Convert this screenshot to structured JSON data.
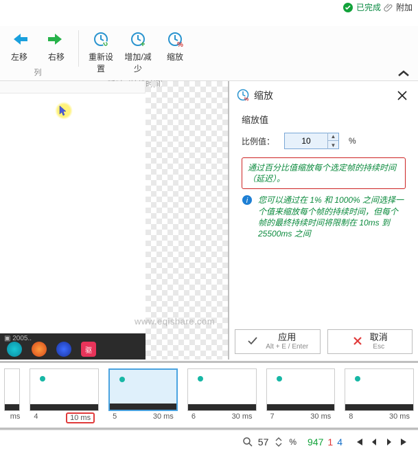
{
  "top": {
    "done": "已完成",
    "attach": "附加"
  },
  "ribbon": {
    "groups": {
      "move": {
        "left": "左移",
        "right": "右移",
        "caption": "列"
      },
      "delay": {
        "reset": "重新设置",
        "inc_dec": "增加/减少",
        "scale": "缩放",
        "caption": "延时（持续时间）"
      }
    }
  },
  "panel": {
    "title": "缩放",
    "section": "缩放值",
    "ratio_label": "比例值：",
    "ratio_value": "10",
    "ratio_unit": "%",
    "tip": "通过百分比值缩放每个选定帧的持续时间（延迟）。",
    "info": "您可以通过在 1% 和 1000% 之间选择一个值来缩放每个帧的持续时间，但每个帧的最终持续时间将限制在 10ms 到 25500ms 之间",
    "apply": "应用",
    "apply_hint": "Alt + E / Enter",
    "cancel": "取消",
    "cancel_hint": "Esc"
  },
  "watermark": "www.eqishare.com",
  "frames": [
    {
      "idx": "",
      "ms": "ms"
    },
    {
      "idx": "4",
      "ms": "10 ms"
    },
    {
      "idx": "5",
      "ms": "30 ms",
      "selected": true
    },
    {
      "idx": "6",
      "ms": "30 ms"
    },
    {
      "idx": "7",
      "ms": "30 ms"
    },
    {
      "idx": "8",
      "ms": "30 ms"
    }
  ],
  "status": {
    "zoom": "57",
    "zoom_unit": "%",
    "g": "947",
    "r": "1",
    "b": "4"
  }
}
